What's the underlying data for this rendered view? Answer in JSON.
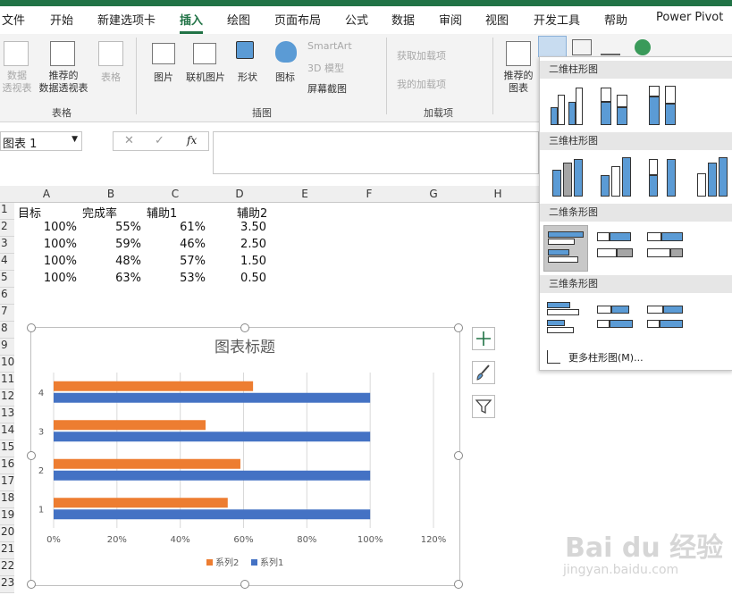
{
  "tabs": [
    "文件",
    "开始",
    "新建选项卡",
    "插入",
    "绘图",
    "页面布局",
    "公式",
    "数据",
    "审阅",
    "视图",
    "开发工具",
    "帮助",
    "Power Pivot"
  ],
  "active_tab": "插入",
  "ribbon": {
    "pivot_label": "数据\n透视表",
    "rec_pivot_label": "推荐的\n数据透视表",
    "table_label": "表格",
    "group_tables": "表格",
    "picture_label": "图片",
    "online_picture_label": "联机图片",
    "shapes_label": "形状",
    "icons_label": "图标",
    "smartart_label": "SmartArt",
    "model3d_label": "3D 模型",
    "screenshot_label": "屏幕截图",
    "group_illustrations": "插图",
    "get_addins_label": "获取加载项",
    "my_addins_label": "我的加载项",
    "group_addins": "加载项",
    "rec_charts_label": "推荐的\n图表"
  },
  "formula_bar": {
    "name_box": "图表 1",
    "cancel": "✕",
    "enter": "✓",
    "fx": "fx"
  },
  "columns": [
    "A",
    "B",
    "C",
    "D",
    "E",
    "F",
    "G",
    "H"
  ],
  "rows": [
    "1",
    "2",
    "3",
    "4",
    "5",
    "6",
    "7",
    "8",
    "9",
    "10",
    "11",
    "12",
    "13",
    "14",
    "15",
    "16",
    "17",
    "18",
    "19",
    "20",
    "21",
    "22",
    "23"
  ],
  "cells": {
    "headers": [
      "目标",
      "完成率",
      "辅助1",
      "辅助2"
    ],
    "data": [
      [
        "100%",
        "55%",
        "61%",
        "3.50"
      ],
      [
        "100%",
        "59%",
        "46%",
        "2.50"
      ],
      [
        "100%",
        "48%",
        "57%",
        "1.50"
      ],
      [
        "100%",
        "63%",
        "53%",
        "0.50"
      ]
    ]
  },
  "chart_data": {
    "type": "bar",
    "orientation": "horizontal",
    "title": "图表标题",
    "categories": [
      "1",
      "2",
      "3",
      "4"
    ],
    "series": [
      {
        "name": "系列1",
        "values": [
          1.0,
          1.0,
          1.0,
          1.0
        ],
        "color": "#4472c4"
      },
      {
        "name": "系列2",
        "values": [
          0.55,
          0.59,
          0.48,
          0.63
        ],
        "color": "#ed7d31"
      }
    ],
    "xticks": [
      "0%",
      "20%",
      "40%",
      "60%",
      "80%",
      "100%",
      "120%"
    ],
    "xlim": [
      0,
      1.2
    ],
    "legend_position": "bottom",
    "legend_order": [
      "系列2",
      "系列1"
    ],
    "grid": true
  },
  "dropdown": {
    "sections": [
      "二维柱形图",
      "三维柱形图",
      "二维条形图",
      "三维条形图"
    ],
    "more_label": "更多柱形图(M)..."
  },
  "colors": {
    "excel_green": "#217346",
    "accent_blue": "#5b9bd5"
  },
  "watermark": {
    "brand": "Bai du 经验",
    "url": "jingyan.baidu.com"
  }
}
